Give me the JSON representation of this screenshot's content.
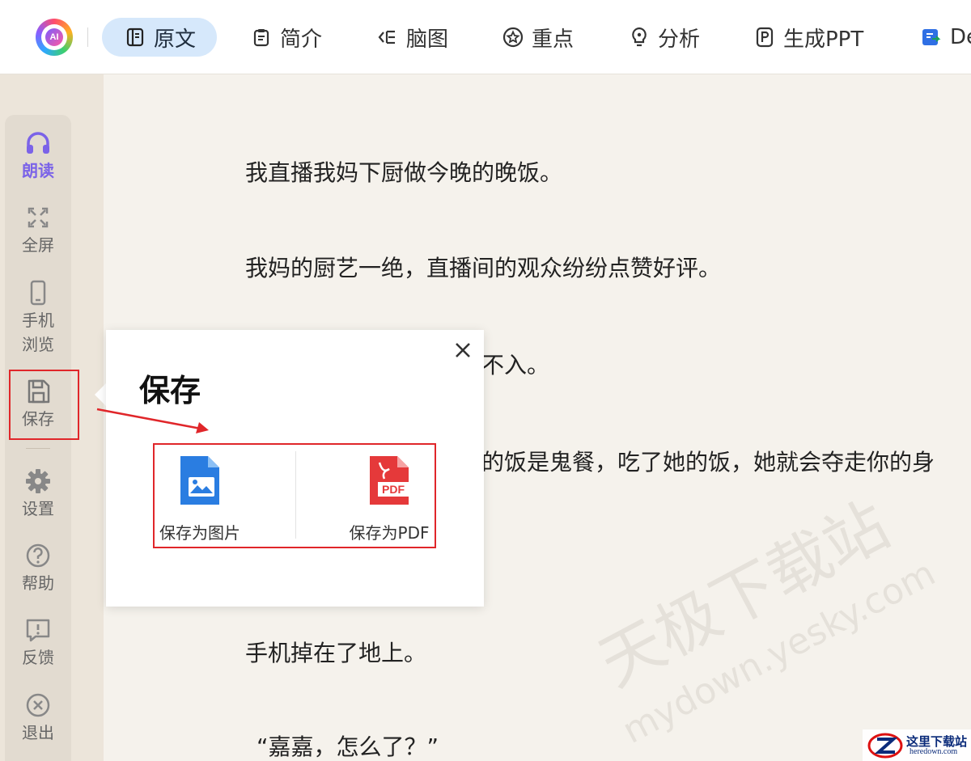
{
  "header": {
    "logo_text": "AI",
    "tabs": [
      {
        "label": "原文",
        "icon": "document-icon",
        "active": true
      },
      {
        "label": "简介",
        "icon": "clipboard-icon",
        "active": false
      },
      {
        "label": "脑图",
        "icon": "mindmap-icon",
        "active": false
      },
      {
        "label": "重点",
        "icon": "star-circle-icon",
        "active": false
      },
      {
        "label": "分析",
        "icon": "lightbulb-icon",
        "active": false
      },
      {
        "label": "生成PPT",
        "icon": "ppt-icon",
        "active": false
      },
      {
        "label": "De",
        "icon": "export-doc-icon",
        "active": false
      }
    ]
  },
  "sidebar": {
    "items": [
      {
        "label": "朗读",
        "icon": "headphones-icon"
      },
      {
        "label": "全屏",
        "icon": "fullscreen-icon"
      },
      {
        "label": "手机\n浏览",
        "label_line1": "手机",
        "label_line2": "浏览",
        "icon": "phone-icon"
      },
      {
        "label": "保存",
        "icon": "save-icon"
      },
      {
        "label": "设置",
        "icon": "gear-icon"
      },
      {
        "label": "帮助",
        "icon": "help-icon"
      },
      {
        "label": "反馈",
        "icon": "feedback-icon"
      },
      {
        "label": "退出",
        "icon": "exit-icon"
      }
    ],
    "accent": "#7b63e8"
  },
  "content": {
    "lines": [
      "我直播我妈下厨做今晚的晚饭。",
      "我妈的厨艺一绝，直播间的观众纷纷点赞好评。",
      "不入。",
      "的饭是鬼餐，吃了她的饭，她就会夺走你的身",
      "手机掉在了地上。",
      "“嘉嘉，怎么了？”"
    ]
  },
  "popup": {
    "title": "保存",
    "close_icon": "close-icon",
    "options": [
      {
        "label": "保存为图片",
        "icon": "image-file-icon",
        "color": "#2a7de1"
      },
      {
        "label": "保存为PDF",
        "icon": "pdf-file-icon",
        "color": "#e5393a",
        "icon_text": "PDF"
      }
    ]
  },
  "watermark": {
    "text_cn": "天极下载站",
    "text_en": "mydown.yesky.com",
    "badge_cn": "这里下载站",
    "badge_en": "heredown.com"
  },
  "colors": {
    "highlight_border": "#e0262a",
    "active_tab_bg": "#d6e8fb",
    "page_bg": "#f5f2ec"
  }
}
